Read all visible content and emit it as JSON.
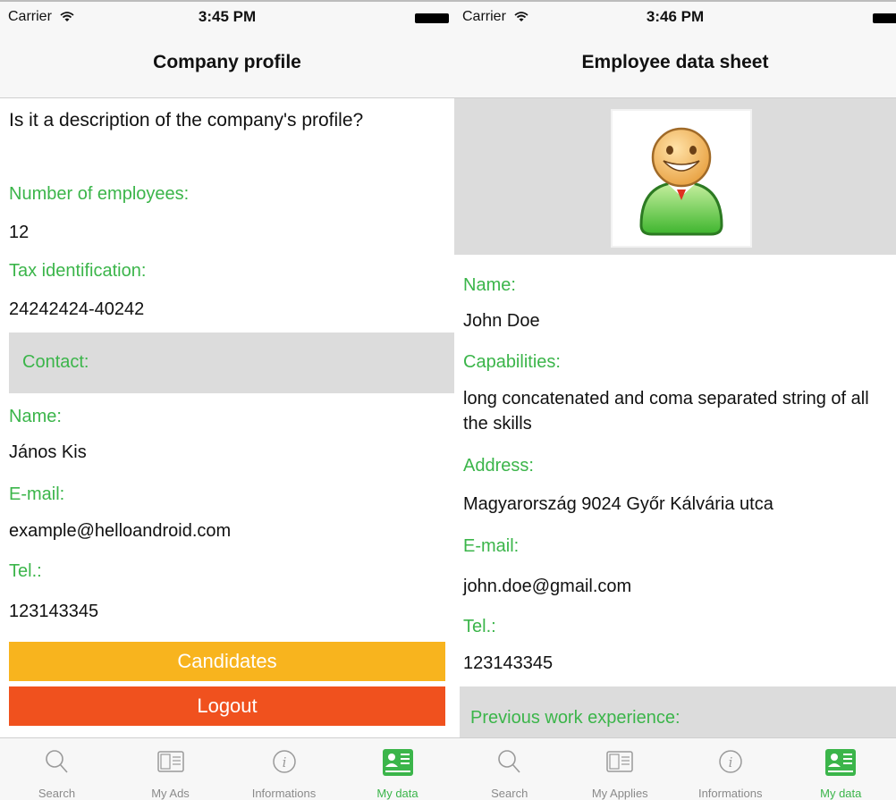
{
  "left": {
    "status": {
      "carrier": "Carrier",
      "time": "3:45 PM"
    },
    "title": "Company profile",
    "description": "Is it a description of the company's profile?",
    "employees_label": "Number of employees:",
    "employees_value": "12",
    "tax_label": "Tax identification:",
    "tax_value": "24242424-40242",
    "contact_header": "Contact:",
    "name_label": "Name:",
    "name_value": "János Kis",
    "email_label": "E-mail:",
    "email_value": "example@helloandroid.com",
    "tel_label": "Tel.:",
    "tel_value": "123143345",
    "candidates_button": "Candidates",
    "logout_button": "Logout",
    "tabs": [
      {
        "label": "Search",
        "icon": "search-icon"
      },
      {
        "label": "My Ads",
        "icon": "ads-icon"
      },
      {
        "label": "Informations",
        "icon": "info-icon"
      },
      {
        "label": "My data",
        "icon": "my-data-icon",
        "active": true
      }
    ]
  },
  "right": {
    "status": {
      "carrier": "Carrier",
      "time": "3:46 PM"
    },
    "title": "Employee data sheet",
    "name_label": "Name:",
    "name_value": "John Doe",
    "capabilities_label": "Capabilities:",
    "capabilities_value": "long concatenated and coma separated string of all the skills",
    "address_label": "Address:",
    "address_value": "Magyarország 9024 Győr Kálvária utca",
    "email_label": "E-mail:",
    "email_value": "john.doe@gmail.com",
    "tel_label": "Tel.:",
    "tel_value": "123143345",
    "work_header": "Previous work experience:",
    "tabs": [
      {
        "label": "Search",
        "icon": "search-icon"
      },
      {
        "label": "My Applies",
        "icon": "applies-icon"
      },
      {
        "label": "Informations",
        "icon": "info-icon"
      },
      {
        "label": "My data",
        "icon": "my-data-icon",
        "active": true
      }
    ]
  },
  "colors": {
    "label_green": "#3bb54a",
    "candidates_yellow": "#f8b41e",
    "logout_red": "#f0511e",
    "section_gray": "#dcdcdc"
  }
}
